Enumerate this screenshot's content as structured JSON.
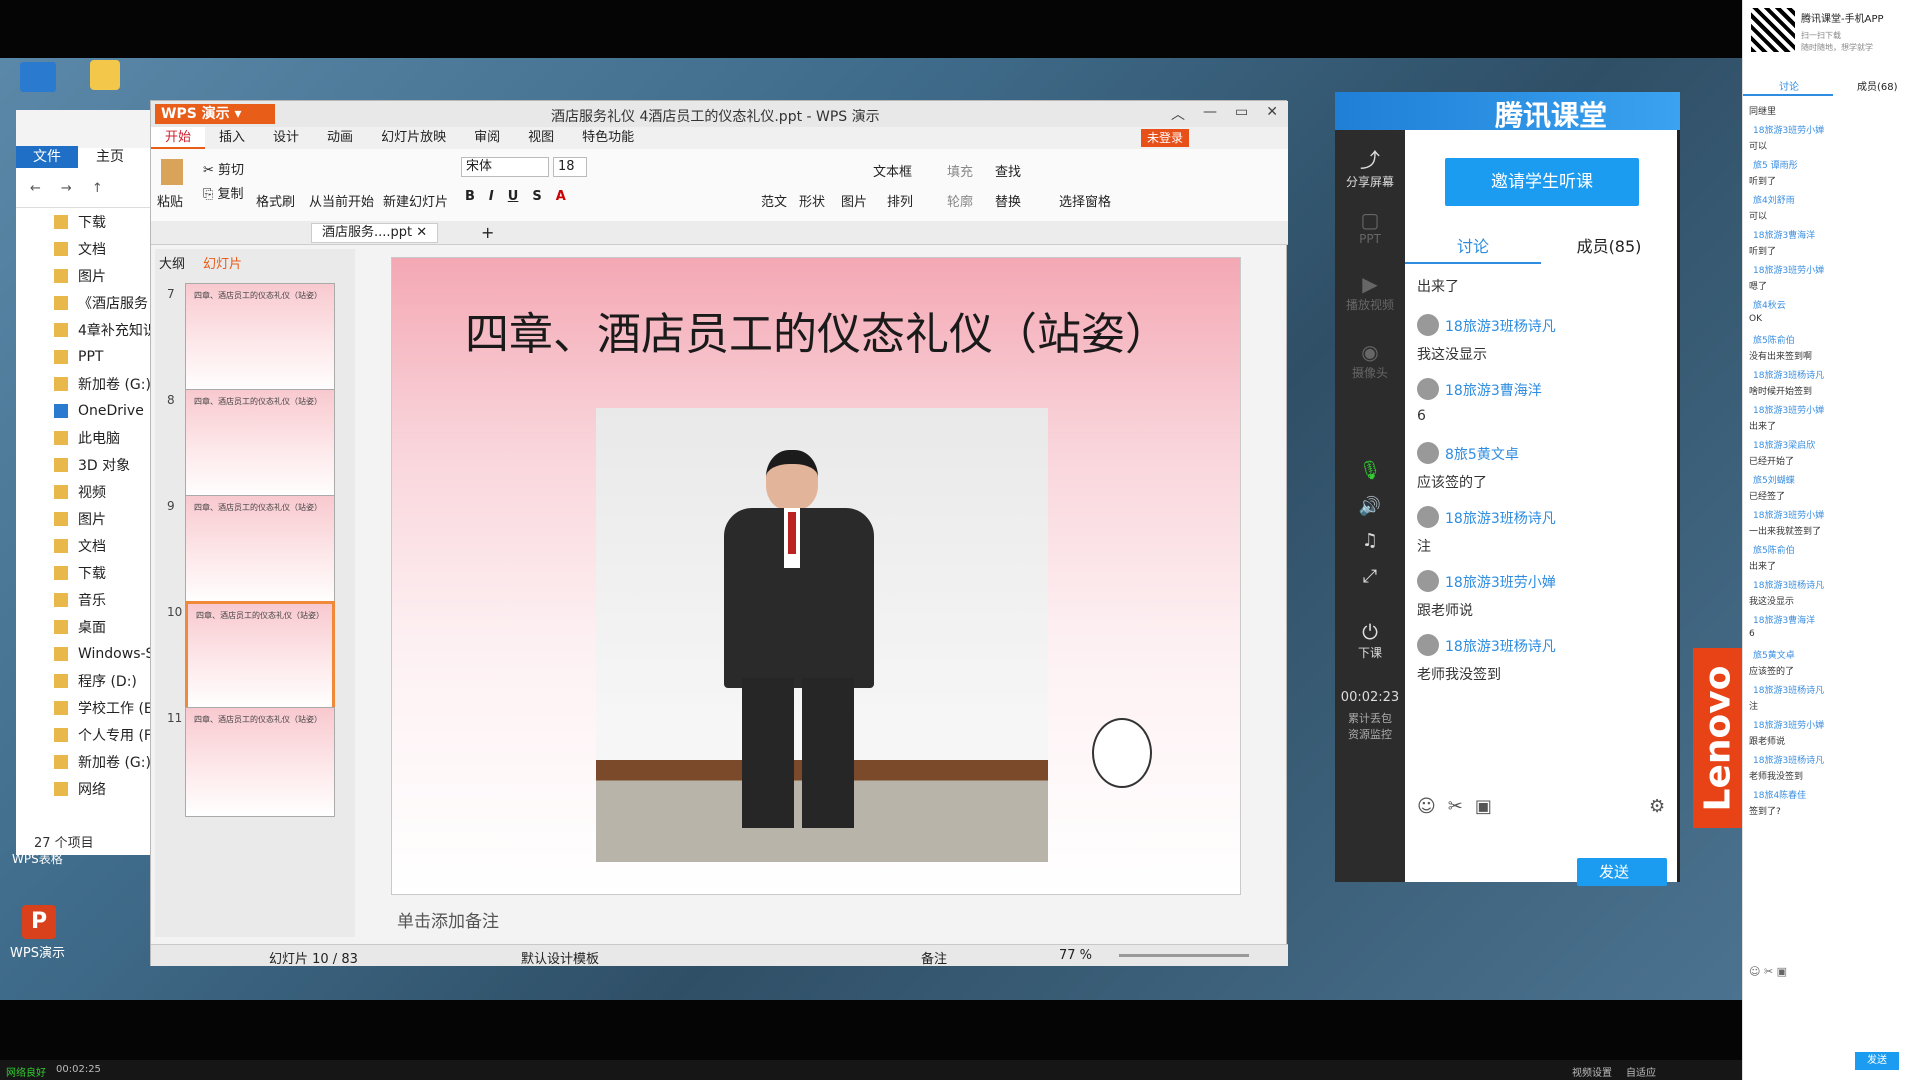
{
  "desktop": {
    "wps_shortcut_label": "WPS演示",
    "wps_table_label": "WPS表格",
    "explorer": {
      "tabs": [
        "文件",
        "主页"
      ],
      "items": [
        "下载",
        "文档",
        "图片",
        "《酒店服务",
        "4章补充知识",
        "PPT",
        "新加卷 (G:)",
        "OneDrive",
        "此电脑",
        "3D 对象",
        "视频",
        "图片",
        "文档",
        "下载",
        "音乐",
        "桌面",
        "Windows-S",
        "程序 (D:)",
        "学校工作 (E",
        "个人专用 (F",
        "新加卷 (G:)",
        "网络"
      ],
      "item_count": "27 个项目"
    }
  },
  "wps": {
    "app_name": "WPS 演示",
    "window_title": "酒店服务礼仪 4酒店员工的仪态礼仪.ppt - WPS 演示",
    "login_badge": "未登录",
    "menus": [
      "开始",
      "插入",
      "设计",
      "动画",
      "幻灯片放映",
      "审阅",
      "视图",
      "特色功能"
    ],
    "ribbon": {
      "paste": "粘贴",
      "cut": "剪切",
      "copy": "复制",
      "format_painter": "格式刷",
      "from_current": "从当前开始",
      "new_slide": "新建幻灯片",
      "font": "宋体",
      "font_size": "18",
      "template": "范文",
      "shape": "形状",
      "picture": "图片",
      "textbox": "文本框",
      "arrange": "排列",
      "fill": "填充",
      "outline": "轮廓",
      "find": "查找",
      "replace": "替换",
      "select_pane": "选择窗格"
    },
    "doc_tab": "酒店服务....ppt",
    "pane_tabs": [
      "大纲",
      "幻灯片"
    ],
    "thumbnails": [
      {
        "num": "7",
        "title": "四章、酒店员工的仪态礼仪（站姿）"
      },
      {
        "num": "8",
        "title": "四章、酒店员工的仪态礼仪（站姿）"
      },
      {
        "num": "9",
        "title": "四章、酒店员工的仪态礼仪（站姿）"
      },
      {
        "num": "10",
        "title": "四章、酒店员工的仪态礼仪（站姿）"
      },
      {
        "num": "11",
        "title": "四章、酒店员工的仪态礼仪（站姿）"
      }
    ],
    "slide_title": "四章、酒店员工的仪态礼仪（站姿）",
    "notes_placeholder": "单击添加备注",
    "status": {
      "slide_counter": "幻灯片 10 / 83",
      "template_name": "默认设计模板",
      "notes_label": "备注",
      "zoom": "77 %"
    }
  },
  "tencent": {
    "brand": "腾讯课堂",
    "side": {
      "share_screen": "分享屏幕",
      "ppt": "PPT",
      "play_video": "播放视频",
      "camera": "摄像头",
      "end_class": "下课",
      "timer": "00:02:23",
      "gift_label": "累计丢包",
      "resource_label": "资源监控"
    },
    "invite_button": "邀请学生听课",
    "tabs": {
      "discussion": "讨论",
      "members": "成员(85)"
    },
    "messages": [
      {
        "name": "",
        "text": "出来了"
      },
      {
        "name": "18旅游3班杨诗凡",
        "text": "我这没显示"
      },
      {
        "name": "18旅游3曹海洋",
        "text": "6"
      },
      {
        "name": "8旅5黄文卓",
        "text": "应该签的了"
      },
      {
        "name": "18旅游3班杨诗凡",
        "text": "注"
      },
      {
        "name": "18旅游3班劳小婵",
        "text": "跟老师说"
      },
      {
        "name": "18旅游3班杨诗凡",
        "text": "老师我没签到"
      }
    ],
    "send_button": "发送"
  },
  "right_panel": {
    "app_title": "腾讯课堂-手机APP",
    "subtitle1": "扫一扫下载",
    "subtitle2": "随时随地，想学就学",
    "tabs": [
      "讨论",
      "成员(68)"
    ],
    "lines": [
      {
        "name": "",
        "text": "同继里"
      },
      {
        "name": "18旅游3班劳小婵",
        "text": "可以"
      },
      {
        "name": "旅5 谭雨彤",
        "text": "听到了"
      },
      {
        "name": "旅4刘舒雨",
        "text": "可以"
      },
      {
        "name": "18旅游3曹海洋",
        "text": "听到了"
      },
      {
        "name": "18旅游3班劳小婵",
        "text": "嗯了"
      },
      {
        "name": "旅4秋云",
        "text": "OK"
      },
      {
        "name": "旅5陈俞伯",
        "text": "没有出来签到啊"
      },
      {
        "name": "18旅游3班杨诗凡",
        "text": "啥时候开始签到"
      },
      {
        "name": "18旅游3班劳小婵",
        "text": "出来了"
      },
      {
        "name": "18旅游3梁启欣",
        "text": "已经开始了"
      },
      {
        "name": "旅5刘蝴蝶",
        "text": "已经签了"
      },
      {
        "name": "18旅游3班劳小婵",
        "text": "一出来我就签到了"
      },
      {
        "name": "旅5陈俞伯",
        "text": "出来了"
      },
      {
        "name": "18旅游3班杨诗凡",
        "text": "我这没显示"
      },
      {
        "name": "18旅游3曹海洋",
        "text": "6"
      },
      {
        "name": "旅5黄文卓",
        "text": "应该签的了"
      },
      {
        "name": "18旅游3班杨诗凡",
        "text": "注"
      },
      {
        "name": "18旅游3班劳小婵",
        "text": "跟老师说"
      },
      {
        "name": "18旅游3班杨诗凡",
        "text": "老师我没签到"
      },
      {
        "name": "18旅4陈春佳",
        "text": "签到了?"
      }
    ],
    "send_button": "发送"
  },
  "bottom_status": {
    "network": "网络良好",
    "time": "00:02:25",
    "video_settings": "视频设置",
    "auto_adapt": "自适应"
  },
  "lenovo": "Lenovo"
}
